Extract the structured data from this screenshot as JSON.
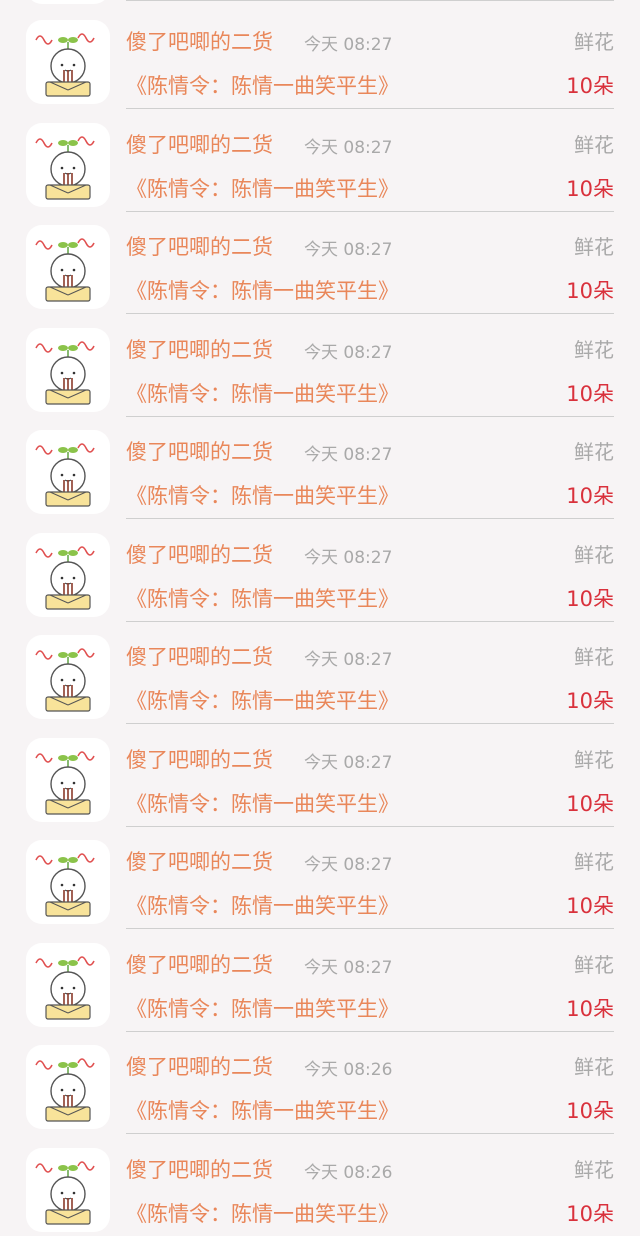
{
  "icons": {
    "avatar": "cartoon-avatar-icon"
  },
  "colors": {
    "name": "#e9875a",
    "title": "#e9875a",
    "count": "#d9313c",
    "muted": "#a9a9a9"
  },
  "rows": [
    {
      "name": "傻了吧唧的二货",
      "time": "今天 08:27",
      "gift": "鲜花",
      "title": "《陈情令：陈情一曲笑平生》",
      "count": "10朵"
    },
    {
      "name": "傻了吧唧的二货",
      "time": "今天 08:27",
      "gift": "鲜花",
      "title": "《陈情令：陈情一曲笑平生》",
      "count": "10朵"
    },
    {
      "name": "傻了吧唧的二货",
      "time": "今天 08:27",
      "gift": "鲜花",
      "title": "《陈情令：陈情一曲笑平生》",
      "count": "10朵"
    },
    {
      "name": "傻了吧唧的二货",
      "time": "今天 08:27",
      "gift": "鲜花",
      "title": "《陈情令：陈情一曲笑平生》",
      "count": "10朵"
    },
    {
      "name": "傻了吧唧的二货",
      "time": "今天 08:27",
      "gift": "鲜花",
      "title": "《陈情令：陈情一曲笑平生》",
      "count": "10朵"
    },
    {
      "name": "傻了吧唧的二货",
      "time": "今天 08:27",
      "gift": "鲜花",
      "title": "《陈情令：陈情一曲笑平生》",
      "count": "10朵"
    },
    {
      "name": "傻了吧唧的二货",
      "time": "今天 08:27",
      "gift": "鲜花",
      "title": "《陈情令：陈情一曲笑平生》",
      "count": "10朵"
    },
    {
      "name": "傻了吧唧的二货",
      "time": "今天 08:27",
      "gift": "鲜花",
      "title": "《陈情令：陈情一曲笑平生》",
      "count": "10朵"
    },
    {
      "name": "傻了吧唧的二货",
      "time": "今天 08:27",
      "gift": "鲜花",
      "title": "《陈情令：陈情一曲笑平生》",
      "count": "10朵"
    },
    {
      "name": "傻了吧唧的二货",
      "time": "今天 08:27",
      "gift": "鲜花",
      "title": "《陈情令：陈情一曲笑平生》",
      "count": "10朵"
    },
    {
      "name": "傻了吧唧的二货",
      "time": "今天 08:26",
      "gift": "鲜花",
      "title": "《陈情令：陈情一曲笑平生》",
      "count": "10朵"
    },
    {
      "name": "傻了吧唧的二货",
      "time": "今天 08:26",
      "gift": "鲜花",
      "title": "《陈情令：陈情一曲笑平生》",
      "count": "10朵"
    }
  ]
}
